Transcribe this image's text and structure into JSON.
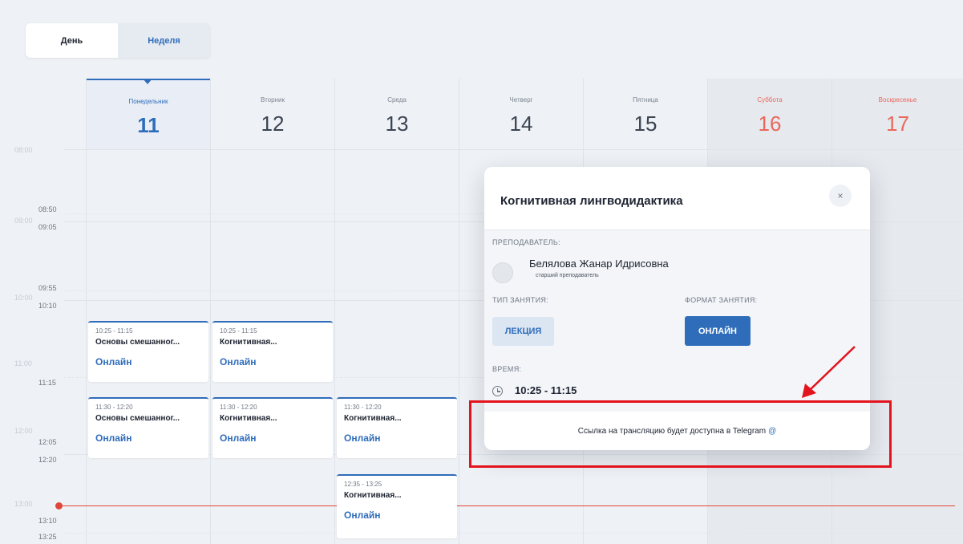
{
  "view_toggle": {
    "day_label": "День",
    "week_label": "Неделя",
    "active": "week"
  },
  "days": [
    {
      "name": "Понедельник",
      "num": "11",
      "active": true,
      "weekend": false
    },
    {
      "name": "Вторник",
      "num": "12",
      "active": false,
      "weekend": false
    },
    {
      "name": "Среда",
      "num": "13",
      "active": false,
      "weekend": false
    },
    {
      "name": "Четверг",
      "num": "14",
      "active": false,
      "weekend": false
    },
    {
      "name": "Пятница",
      "num": "15",
      "active": false,
      "weekend": false
    },
    {
      "name": "Суббота",
      "num": "16",
      "active": false,
      "weekend": true
    },
    {
      "name": "Воскресенье",
      "num": "17",
      "active": false,
      "weekend": true
    }
  ],
  "times": [
    "08:50",
    "09:05",
    "09:55",
    "10:10",
    "11:15",
    "12:05",
    "12:20",
    "13:10",
    "13:25"
  ],
  "faint_times": [
    "08:00",
    "09:00",
    "10:00",
    "11:00",
    "12:00",
    "13:00"
  ],
  "events": [
    {
      "day": 0,
      "time": "10:25 - 11:15",
      "title": "Основы смешанног...",
      "format": "Онлайн"
    },
    {
      "day": 1,
      "time": "10:25 - 11:15",
      "title": "Когнитивная...",
      "format": "Онлайн"
    },
    {
      "day": 0,
      "time": "11:30 - 12:20",
      "title": "Основы смешанног...",
      "format": "Онлайн"
    },
    {
      "day": 1,
      "time": "11:30 - 12:20",
      "title": "Когнитивная...",
      "format": "Онлайн"
    },
    {
      "day": 2,
      "time": "11:30 - 12:20",
      "title": "Когнитивная...",
      "format": "Онлайн"
    },
    {
      "day": 2,
      "time": "12:35 - 13:25",
      "title": "Когнитивная...",
      "format": "Онлайн"
    }
  ],
  "modal": {
    "title": "Когнитивная лингводидактика",
    "close_label": "×",
    "teacher_label": "ПРЕПОДАВАТЕЛЬ:",
    "teacher_name": "Белялова Жанар Идрисовна",
    "teacher_role": "старший преподаватель",
    "type_label": "ТИП ЗАНЯТИЯ:",
    "type_value": "ЛЕКЦИЯ",
    "format_label": "ФОРМАТ ЗАНЯТИЯ:",
    "format_value": "ОНЛАЙН",
    "time_label": "ВРЕМЯ:",
    "time_value": "10:25 - 11:15",
    "footer_text": "Ссылка на трансляцию будет доступна в Telegram",
    "footer_icon": "@"
  },
  "colors": {
    "accent": "#2f6dbb",
    "weekend": "#e9685c",
    "now_line": "#e0473a",
    "annotation": "#e3141d"
  }
}
